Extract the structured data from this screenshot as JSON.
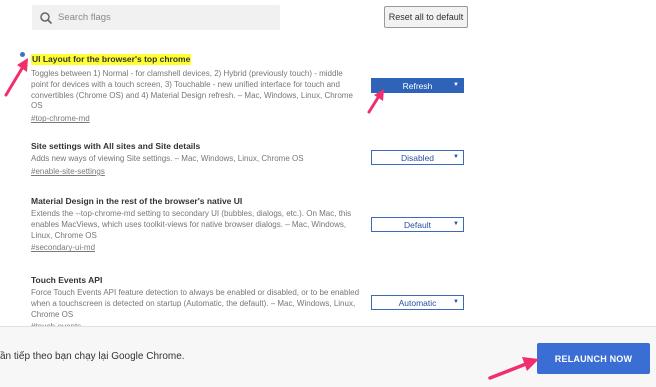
{
  "search": {
    "placeholder": "Search flags"
  },
  "toolbar": {
    "reset_label": "Reset all to default"
  },
  "flags": [
    {
      "title": "UI Layout for the browser's top chrome",
      "description": "Toggles between 1) Normal - for clamshell devices, 2) Hybrid (previously touch) - middle point for devices with a touch screen, 3) Touchable - new unified interface for touch and convertibles (Chrome OS) and 4) Material Design refresh. – Mac, Windows, Linux, Chrome OS",
      "link": "#top-chrome-md",
      "selected": "Refresh"
    },
    {
      "title": "Site settings with All sites and Site details",
      "description": "Adds new ways of viewing Site settings. – Mac, Windows, Linux, Chrome OS",
      "link": "#enable-site-settings",
      "selected": "Disabled"
    },
    {
      "title": "Material Design in the rest of the browser's native UI",
      "description": "Extends the --top-chrome-md setting to secondary UI (bubbles, dialogs, etc.). On Mac, this enables MacViews, which uses toolkit-views for native browser dialogs. – Mac, Windows, Linux, Chrome OS",
      "link": "#secondary-ui-md",
      "selected": "Default"
    },
    {
      "title": "Touch Events API",
      "description": "Force Touch Events API feature detection to always be enabled or disabled, or to be enabled when a touchscreen is detected on startup (Automatic, the default). – Mac, Windows, Linux, Chrome OS",
      "link": "#touch-events",
      "selected": "Automatic"
    }
  ],
  "relaunch": {
    "message": "ần tiếp theo bạn chạy lại Google Chrome.",
    "button_label": "RELAUNCH NOW"
  },
  "colors": {
    "highlight": "#ffff33",
    "accent": "#3a6ed4",
    "arrow": "#f0306e"
  }
}
